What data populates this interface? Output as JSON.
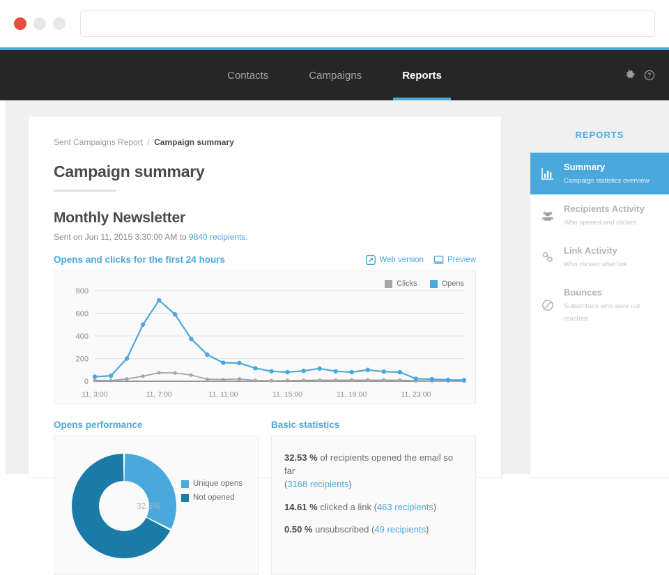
{
  "browser": {
    "url_value": "",
    "url_placeholder": "",
    "accent": "#4aa8dd",
    "close_dot": "#e84c3d"
  },
  "topnav": {
    "background": "#262626",
    "tabs": [
      {
        "label": "Contacts",
        "active": false
      },
      {
        "label": "Campaigns",
        "active": false
      },
      {
        "label": "Reports",
        "active": true
      }
    ],
    "icons": [
      {
        "name": "gear-icon",
        "glyph": "⚙"
      },
      {
        "name": "help-icon",
        "glyph": "?"
      }
    ]
  },
  "breadcrumb": {
    "parent": "Sent Campaigns Report",
    "separator": "/",
    "current": "Campaign summary"
  },
  "page": {
    "title": "Campaign summary",
    "campaign_name": "Monthly Newsletter",
    "sent_prefix": "Sent on Jun 11, 2015 3:30:00 AM to ",
    "sent_link": "9840 recipients."
  },
  "chart_section": {
    "title": "Opens and clicks for the first 24 hours",
    "actions": [
      {
        "label": "Web version",
        "icon": "external-link-icon"
      },
      {
        "label": "Preview",
        "icon": "monitor-icon"
      }
    ]
  },
  "opens_performance": {
    "title": "Opens performance",
    "center_label": "32.5%",
    "legend": [
      {
        "label": "Unique opens",
        "color": "#4aa8dd"
      },
      {
        "label": "Not opened",
        "color": "#1a7aa8"
      }
    ]
  },
  "basic_statistics": {
    "title": "Basic statistics",
    "lines": [
      {
        "value": "32.53 %",
        "text": " of recipients opened the email so far",
        "detail_open": "(",
        "detail_link": "3168 recipients",
        "detail_close": ")"
      },
      {
        "value": "14.61 %",
        "text": " clicked a link (",
        "detail_link": "463 recipients",
        "detail_close": ")"
      },
      {
        "value": "0.50 %",
        "text": " unsubscribed (",
        "detail_link": "49 recipients",
        "detail_close": ")"
      }
    ]
  },
  "sidebar": {
    "header": "REPORTS",
    "items": [
      {
        "title": "Summary",
        "subtitle": "Campaign statistics overview",
        "icon": "bar-chart-icon",
        "active": true
      },
      {
        "title": "Recipients Activity",
        "subtitle": "Who opened and clicked",
        "icon": "people-icon",
        "active": false
      },
      {
        "title": "Link Activity",
        "subtitle": "Who clicked what link",
        "icon": "link-icon",
        "active": false
      },
      {
        "title": "Bounces",
        "subtitle": "Subscribers who were not reached",
        "icon": "no-entry-icon",
        "active": false
      }
    ]
  },
  "chart_data": {
    "type": "line",
    "title": "Opens and clicks for the first 24 hours",
    "xlabel": "",
    "ylabel": "",
    "ylim": [
      0,
      800
    ],
    "yticks": [
      0,
      200,
      400,
      600,
      800
    ],
    "grid": true,
    "legend_position": "top-right",
    "x": [
      "11, 3:00",
      "11, 4:00",
      "11, 5:00",
      "11, 6:00",
      "11, 7:00",
      "11, 8:00",
      "11, 9:00",
      "11, 10:00",
      "11, 11:00",
      "11, 12:00",
      "11, 13:00",
      "11, 14:00",
      "11, 15:00",
      "11, 16:00",
      "11, 17:00",
      "11, 18:00",
      "11, 19:00",
      "11, 20:00",
      "11, 21:00",
      "11, 22:00",
      "11, 23:00",
      "12, 0:00",
      "12, 1:00",
      "12, 2:00"
    ],
    "xtick_labels": [
      "11, 3:00",
      "11, 7:00",
      "11, 11:00",
      "11, 15:00",
      "11, 19:00",
      "11, 23:00"
    ],
    "xtick_indices": [
      0,
      4,
      8,
      12,
      16,
      20
    ],
    "series": [
      {
        "name": "Opens",
        "color": "#4aa8dd",
        "values": [
          40,
          48,
          200,
          500,
          715,
          590,
          375,
          235,
          163,
          161,
          115,
          88,
          80,
          92,
          112,
          88,
          80,
          100,
          85,
          80,
          22,
          18,
          12,
          10
        ]
      },
      {
        "name": "Clicks",
        "color": "#a0a7ad",
        "values": [
          8,
          6,
          20,
          45,
          75,
          73,
          55,
          18,
          15,
          20,
          7,
          5,
          6,
          8,
          9,
          9,
          10,
          10,
          10,
          9,
          5,
          4,
          3,
          3
        ]
      }
    ]
  }
}
